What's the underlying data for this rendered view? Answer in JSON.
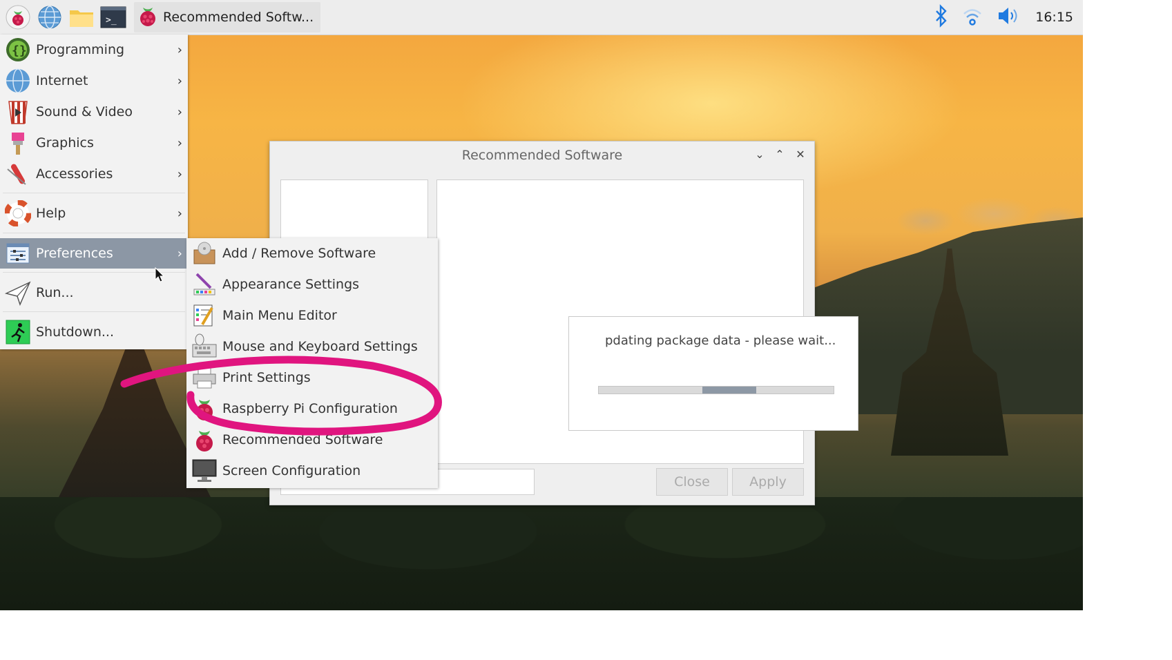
{
  "taskbar": {
    "launchers": [
      "raspberry-menu-icon",
      "web-browser-icon",
      "file-manager-icon",
      "terminal-icon"
    ],
    "window_label": "Recommended Softw...",
    "tray": [
      "bluetooth-icon",
      "wifi-icon",
      "volume-icon"
    ],
    "clock": "16:15"
  },
  "menu": {
    "items": [
      {
        "label": "Programming",
        "icon": "programming-icon"
      },
      {
        "label": "Internet",
        "icon": "internet-icon"
      },
      {
        "label": "Sound & Video",
        "icon": "sound-video-icon"
      },
      {
        "label": "Graphics",
        "icon": "graphics-icon"
      },
      {
        "label": "Accessories",
        "icon": "accessories-icon"
      },
      {
        "label": "Help",
        "icon": "help-icon"
      },
      {
        "label": "Preferences",
        "icon": "preferences-icon",
        "active": true
      },
      {
        "label": "Run...",
        "icon": "run-icon"
      },
      {
        "label": "Shutdown...",
        "icon": "shutdown-icon"
      }
    ],
    "chevron": "›"
  },
  "submenu": {
    "items": [
      {
        "label": "Add / Remove Software",
        "icon": "package-icon"
      },
      {
        "label": "Appearance Settings",
        "icon": "appearance-icon"
      },
      {
        "label": "Main Menu Editor",
        "icon": "menu-editor-icon"
      },
      {
        "label": "Mouse and Keyboard Settings",
        "icon": "mouse-keyboard-icon"
      },
      {
        "label": "Print Settings",
        "icon": "printer-icon"
      },
      {
        "label": "Raspberry Pi Configuration",
        "icon": "raspberry-icon"
      },
      {
        "label": "Recommended Software",
        "icon": "raspberry-icon"
      },
      {
        "label": "Screen Configuration",
        "icon": "monitor-icon"
      }
    ]
  },
  "dialog": {
    "title": "Recommended Software",
    "controls": {
      "minimize": "⌄",
      "maximize": "⌃",
      "close": "✕"
    },
    "progress_text": "pdating package data - please wait...",
    "progress": {
      "start": 0.44,
      "end": 0.67
    },
    "close_label": "Close",
    "apply_label": "Apply"
  },
  "colors": {
    "menu_active": "#8c97a5",
    "annotation": "#e0157f"
  }
}
